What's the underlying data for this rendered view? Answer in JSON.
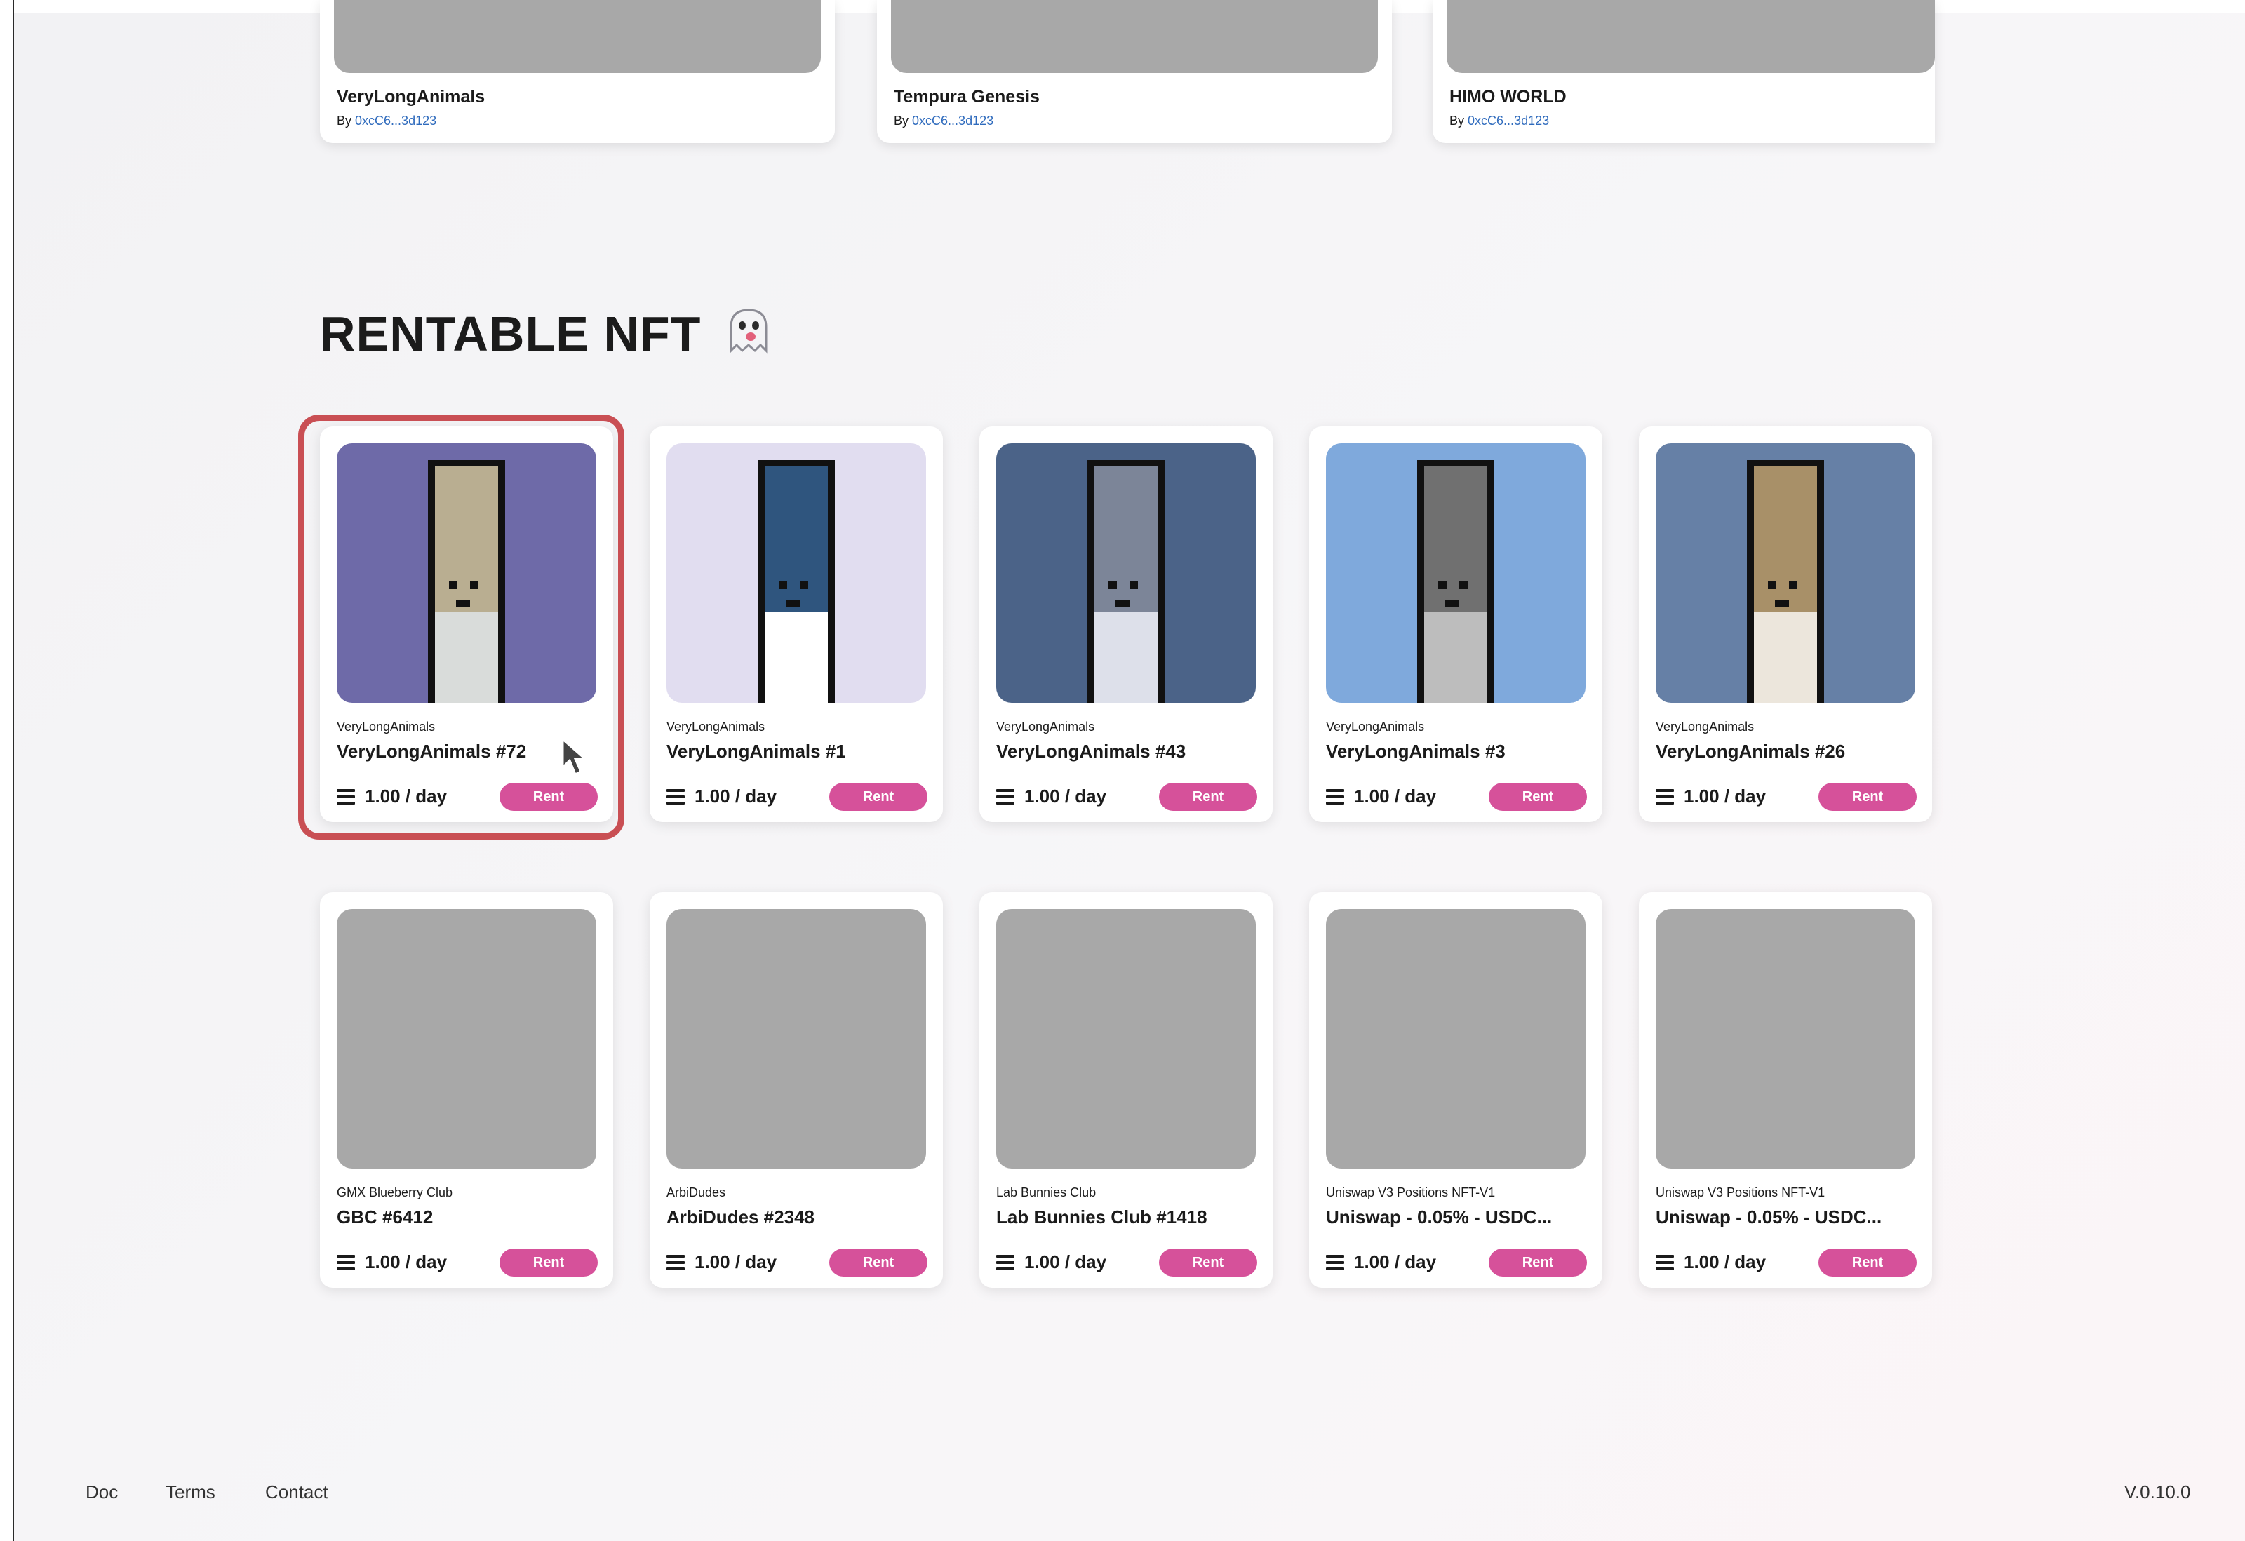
{
  "collections": [
    {
      "name": "VeryLongAnimals",
      "by": "By",
      "address": "0xcC6...3d123"
    },
    {
      "name": "Tempura Genesis",
      "by": "By",
      "address": "0xcC6...3d123"
    },
    {
      "name": "HIMO WORLD",
      "by": "By",
      "address": "0xcC6...3d123"
    }
  ],
  "section": {
    "title": "RENTABLE NFT",
    "icon": "ghost-icon"
  },
  "nfts": [
    {
      "collection": "VeryLongAnimals",
      "title": "VeryLongAnimals #72",
      "price": "1.00 / day",
      "button": "Rent",
      "bg": "#6e6aa8",
      "body": "#b9ae91",
      "belly": "#d9dcda"
    },
    {
      "collection": "VeryLongAnimals",
      "title": "VeryLongAnimals #1",
      "price": "1.00 / day",
      "button": "Rent",
      "bg": "#e1ddf0",
      "body": "#2f557e",
      "belly": "#ffffff"
    },
    {
      "collection": "VeryLongAnimals",
      "title": "VeryLongAnimals #43",
      "price": "1.00 / day",
      "button": "Rent",
      "bg": "#4b6388",
      "body": "#7c8598",
      "belly": "#dde0ea"
    },
    {
      "collection": "VeryLongAnimals",
      "title": "VeryLongAnimals #3",
      "price": "1.00 / day",
      "button": "Rent",
      "bg": "#7fa9dc",
      "body": "#707070",
      "belly": "#bdbdbd"
    },
    {
      "collection": "VeryLongAnimals",
      "title": "VeryLongAnimals #26",
      "price": "1.00 / day",
      "button": "Rent",
      "bg": "#6680a6",
      "body": "#a89068",
      "belly": "#ece6dc"
    },
    {
      "collection": "GMX Blueberry Club",
      "title": "GBC #6412",
      "price": "1.00 / day",
      "button": "Rent"
    },
    {
      "collection": "ArbiDudes",
      "title": "ArbiDudes #2348",
      "price": "1.00 / day",
      "button": "Rent"
    },
    {
      "collection": "Lab Bunnies Club",
      "title": "Lab Bunnies Club #1418",
      "price": "1.00 / day",
      "button": "Rent"
    },
    {
      "collection": "Uniswap V3 Positions NFT-V1",
      "title": "Uniswap - 0.05% - USDC...",
      "price": "1.00 / day",
      "button": "Rent"
    },
    {
      "collection": "Uniswap V3 Positions NFT-V1",
      "title": "Uniswap - 0.05% - USDC...",
      "price": "1.00 / day",
      "button": "Rent"
    }
  ],
  "footer": {
    "doc": "Doc",
    "terms": "Terms",
    "contact": "Contact",
    "version": "V.0.10.0"
  },
  "colors": {
    "accent": "#d6519a",
    "highlight": "#c94f54",
    "link": "#2f6bbd",
    "placeholder": "#a8a8a8"
  }
}
